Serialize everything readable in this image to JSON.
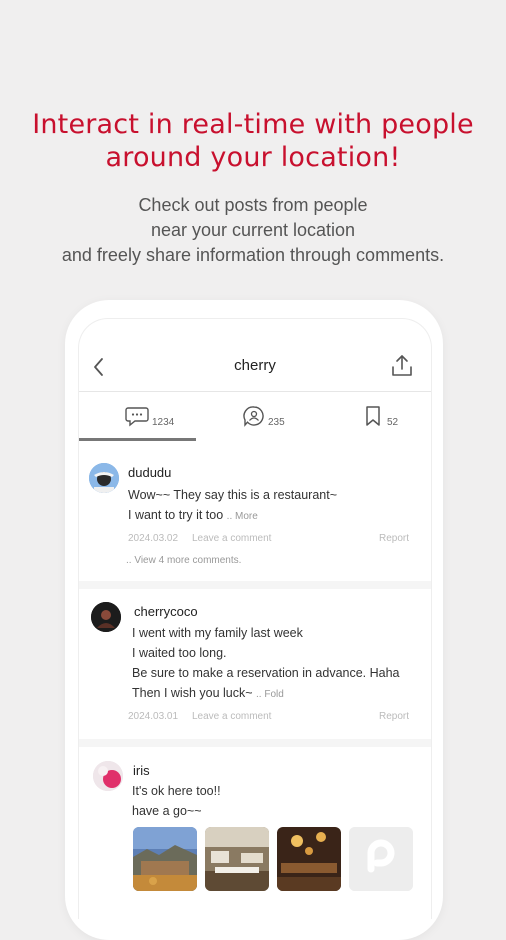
{
  "headline": {
    "line1": "Interact in real-time with people",
    "line2": "around your location!"
  },
  "subtitle": {
    "line1": "Check out posts from people",
    "line2": "near your current location",
    "line3": "and freely share information through comments."
  },
  "screen": {
    "title": "cherry",
    "tabs": [
      {
        "icon": "comment-icon",
        "count": "1234",
        "active": true
      },
      {
        "icon": "user-tag-icon",
        "count": "235",
        "active": false
      },
      {
        "icon": "bookmark-icon",
        "count": "52",
        "active": false
      }
    ],
    "posts": [
      {
        "username": "dududu",
        "lines": [
          "Wow~~ They say this is a restaurant~",
          "I want to try it too"
        ],
        "toggle": ".. More",
        "date": "2024.03.02",
        "leave_comment": "Leave a comment",
        "report": "Report",
        "view_more": ".. View 4 more comments."
      },
      {
        "username": "cherrycoco",
        "lines": [
          "I went with my family last week",
          "I waited too long.",
          "Be sure to make a reservation in advance. Haha",
          "Then I wish you luck~"
        ],
        "toggle": ".. Fold",
        "date": "2024.03.01",
        "leave_comment": "Leave a comment",
        "report": "Report"
      },
      {
        "username": "iris",
        "lines": [
          "It's ok here too!!",
          "have a go~~"
        ],
        "images": [
          "landscape-photo",
          "restaurant-interior-photo",
          "dining-room-photo",
          "placeholder-logo"
        ]
      }
    ]
  },
  "colors": {
    "accent": "#c8102e",
    "background": "#f0efef"
  }
}
